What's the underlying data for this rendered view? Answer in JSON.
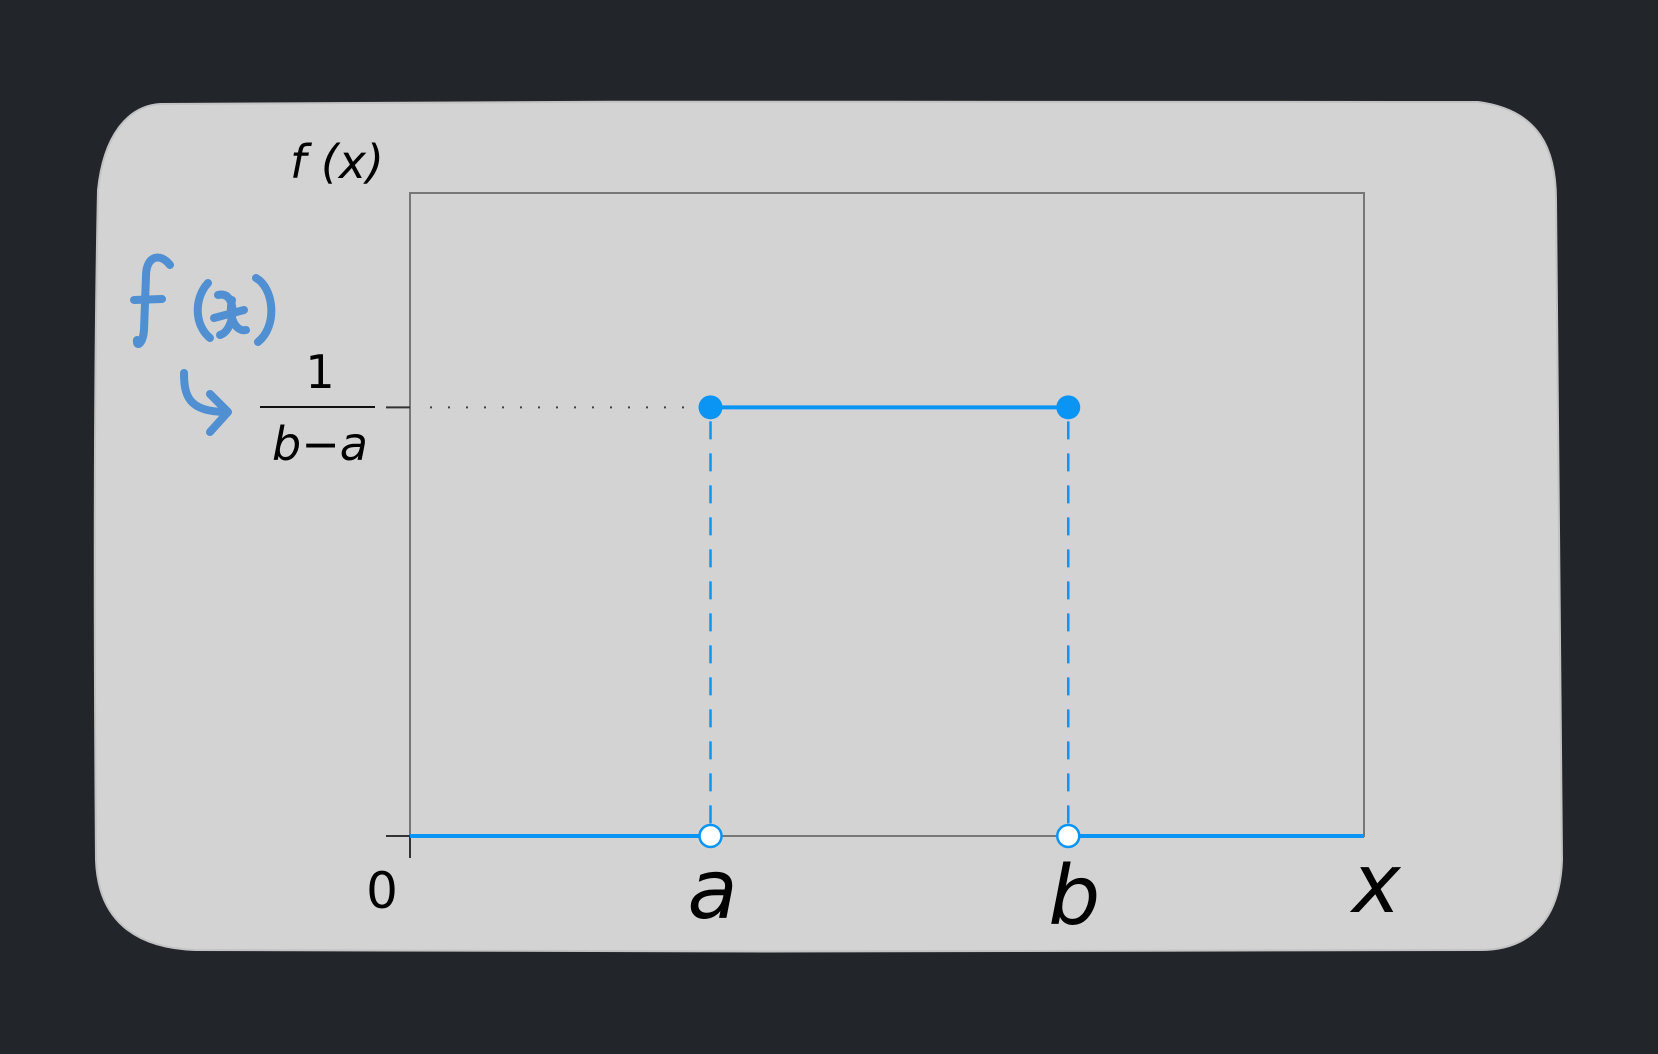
{
  "chart_data": {
    "type": "line",
    "ylabel": "f (x)",
    "xlabel": "x",
    "x_tick_labels": [
      "0",
      "a",
      "b"
    ],
    "y_tick_label": {
      "numerator": "1",
      "denominator_left": "b",
      "denominator_op": "−",
      "denominator_right": "a"
    },
    "xlim": [
      0,
      1
    ],
    "ylim": [
      0,
      1.5
    ],
    "a": 0.315,
    "b": 0.69,
    "density": 1,
    "series": [
      {
        "segments": [
          {
            "x": [
              0,
              0.315
            ],
            "y": [
              0,
              0
            ]
          },
          {
            "x": [
              0.315,
              0.69
            ],
            "y": [
              1,
              1
            ]
          },
          {
            "x": [
              0.69,
              1
            ],
            "y": [
              0,
              0
            ]
          }
        ]
      }
    ],
    "closed_points": [
      {
        "x": 0.315,
        "y": 1
      },
      {
        "x": 0.69,
        "y": 1
      }
    ],
    "open_points": [
      {
        "x": 0.315,
        "y": 0
      },
      {
        "x": 0.69,
        "y": 0
      }
    ],
    "guide_dashed": [
      {
        "x": 0.315
      },
      {
        "x": 0.69
      }
    ],
    "guide_dotted": {
      "y": 1
    },
    "grid": false,
    "colors": {
      "series": "#0a95f5",
      "card": "#d3d3d3",
      "page": "#22252a",
      "axes": "#777777",
      "annotation": "#4f8fd2"
    }
  },
  "annotation": {
    "handwritten_text": "f(x)",
    "icon": "curved-arrow-icon"
  }
}
